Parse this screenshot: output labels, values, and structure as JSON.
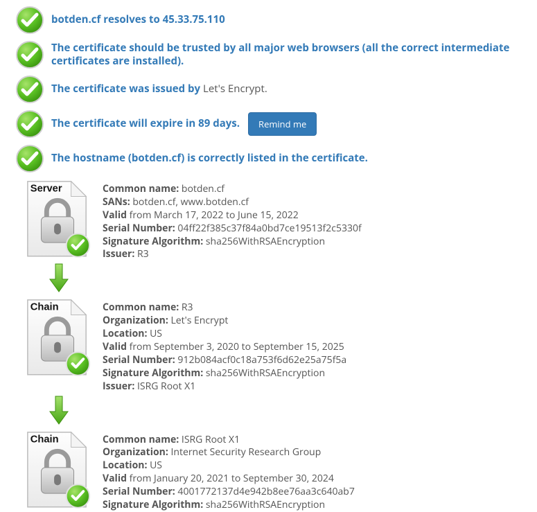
{
  "checks": {
    "resolves": "botden.cf resolves to 45.33.75.110",
    "trusted": "The certificate should be trusted by all major web browsers (all the correct intermediate certificates are installed).",
    "issued_prefix": "The certificate was issued by ",
    "issued_issuer": "Let's Encrypt",
    "issued_suffix": ".",
    "expire": "The certificate will expire in 89 days.",
    "remind_btn": "Remind me",
    "hostname": "The hostname (botden.cf) is correctly listed in the certificate."
  },
  "certs": [
    {
      "badge": "Server",
      "cn_label": "Common name:",
      "cn_value": " botden.cf",
      "sans_label": "SANs:",
      "sans_value": " botden.cf, www.botden.cf",
      "valid_label": "Valid",
      "valid_value": " from March 17, 2022 to June 15, 2022",
      "serial_label": "Serial Number:",
      "serial_value": " 04ff22f385c37f84a0bd7ce19513f2c5330f",
      "sigalg_label": "Signature Algorithm:",
      "sigalg_value": " sha256WithRSAEncryption",
      "issuer_label": "Issuer:",
      "issuer_value": " R3"
    },
    {
      "badge": "Chain",
      "cn_label": "Common name:",
      "cn_value": " R3",
      "org_label": "Organization:",
      "org_value": " Let's Encrypt",
      "loc_label": "Location:",
      "loc_value": " US",
      "valid_label": "Valid",
      "valid_value": " from September 3, 2020 to September 15, 2025",
      "serial_label": "Serial Number:",
      "serial_value": " 912b084acf0c18a753f6d62e25a75f5a",
      "sigalg_label": "Signature Algorithm:",
      "sigalg_value": " sha256WithRSAEncryption",
      "issuer_label": "Issuer:",
      "issuer_value": " ISRG Root X1"
    },
    {
      "badge": "Chain",
      "cn_label": "Common name:",
      "cn_value": " ISRG Root X1",
      "org_label": "Organization:",
      "org_value": " Internet Security Research Group",
      "loc_label": "Location:",
      "loc_value": " US",
      "valid_label": "Valid",
      "valid_value": " from January 20, 2021 to September 30, 2024",
      "serial_label": "Serial Number:",
      "serial_value": " 4001772137d4e942b8ee76aa3c640ab7",
      "sigalg_label": "Signature Algorithm:",
      "sigalg_value": " sha256WithRSAEncryption"
    }
  ]
}
